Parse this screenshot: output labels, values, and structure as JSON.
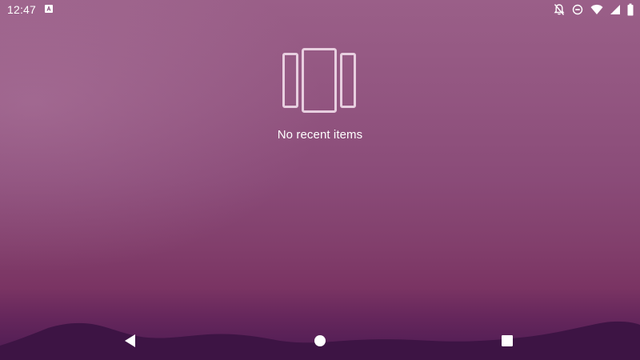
{
  "status_bar": {
    "time": "12:47",
    "notification_icon": "android-a-icon",
    "icons": [
      "notifications-off-icon",
      "do-not-disturb-icon",
      "wifi-icon",
      "cell-signal-icon",
      "battery-icon"
    ]
  },
  "recents": {
    "empty_icon": "recents-cards-icon",
    "empty_text": "No recent items"
  },
  "nav_bar": {
    "buttons": [
      "back-icon",
      "home-icon",
      "overview-icon"
    ]
  },
  "colors": {
    "wallpaper_top": "#9a5f88",
    "wallpaper_bottom": "#4b1a52",
    "hills": "#3d1444",
    "icon_outline": "#e8cfe0"
  }
}
